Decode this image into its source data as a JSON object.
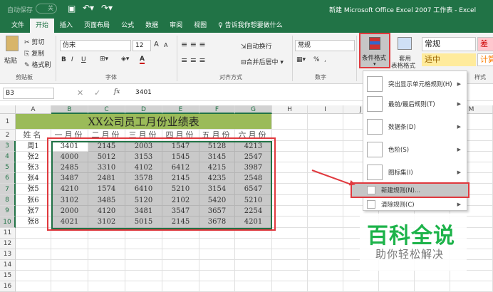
{
  "titlebar": {
    "autosave": "自动保存",
    "autosave_state": "关",
    "title": "新建 Microsoft Office Excel 2007 工作表 - Excel"
  },
  "tabs": [
    "文件",
    "开始",
    "插入",
    "页面布局",
    "公式",
    "数据",
    "审阅",
    "视图"
  ],
  "tell_me": "告诉我你想要做什么",
  "ribbon": {
    "clipboard": {
      "paste": "粘贴",
      "cut": "剪切",
      "copy": "复制",
      "painter": "格式刷",
      "group": "剪贴板"
    },
    "font": {
      "name": "仿宋",
      "size": "12",
      "group": "字体",
      "bold": "B",
      "italic": "I",
      "underline": "U",
      "grow": "A",
      "shrink": "A",
      "color_a": "A"
    },
    "align": {
      "wrap": "自动换行",
      "merge": "合并后居中",
      "group": "对齐方式"
    },
    "number": {
      "format": "常规",
      "percent": "%",
      "comma": ",",
      "group": "数字"
    },
    "styles": {
      "cond_format": "条件格式",
      "table_format_1": "套用",
      "table_format_2": "表格格式",
      "normal": "常规",
      "bad": "差",
      "neutral": "适中",
      "calc": "计算",
      "group": "样式"
    }
  },
  "formula_bar": {
    "name_box": "B3",
    "fx": "fx",
    "value": "3401"
  },
  "columns": [
    "A",
    "B",
    "C",
    "D",
    "E",
    "F",
    "G",
    "H",
    "I",
    "J",
    "K",
    "L",
    "M"
  ],
  "rows": [
    "1",
    "2",
    "3",
    "4",
    "5",
    "6",
    "7",
    "8",
    "9",
    "10",
    "11",
    "12",
    "13",
    "14",
    "15",
    "16"
  ],
  "sheet": {
    "title": "XX公司员工月份业绩表",
    "headers": [
      "姓名",
      "一月份",
      "二月份",
      "三月份",
      "四月份",
      "五月份",
      "六月份"
    ],
    "data": [
      [
        "周1",
        "3401",
        "2145",
        "2003",
        "1547",
        "5128",
        "4213"
      ],
      [
        "张2",
        "4000",
        "5012",
        "3153",
        "1545",
        "3145",
        "2547"
      ],
      [
        "张3",
        "2485",
        "3310",
        "4102",
        "6412",
        "4215",
        "3987"
      ],
      [
        "张4",
        "3487",
        "2481",
        "3578",
        "2145",
        "4235",
        "2548"
      ],
      [
        "张5",
        "4210",
        "1574",
        "6410",
        "5210",
        "3154",
        "6547"
      ],
      [
        "张6",
        "3102",
        "3485",
        "5120",
        "2102",
        "5420",
        "5210"
      ],
      [
        "张7",
        "2000",
        "4120",
        "3481",
        "3547",
        "3657",
        "2254"
      ],
      [
        "张8",
        "4021",
        "3102",
        "5015",
        "2145",
        "3678",
        "4201"
      ]
    ]
  },
  "menu": [
    {
      "label": "突出显示单元格规则(H)",
      "sub": true
    },
    {
      "label": "最前/最后规则(T)",
      "sub": true
    },
    {
      "label": "数据条(D)",
      "sub": true
    },
    {
      "label": "色阶(S)",
      "sub": true
    },
    {
      "label": "图标集(I)",
      "sub": true
    },
    {
      "label": "新建规则(N)...",
      "sub": false
    },
    {
      "label": "清除规则(C)",
      "sub": true
    }
  ],
  "watermark": {
    "title": "百科全说",
    "subtitle": "助你轻松解决"
  },
  "colors": {
    "excel_green": "#217346",
    "title_fill": "#9bbb59",
    "highlight_red": "#e0393e",
    "watermark_green": "#1db34a"
  }
}
